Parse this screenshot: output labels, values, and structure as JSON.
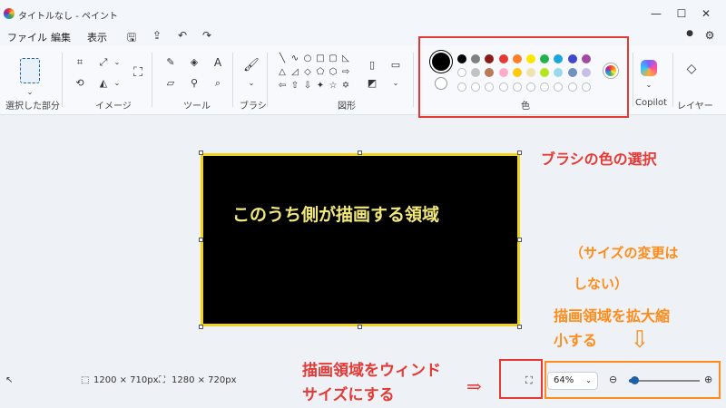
{
  "window": {
    "title": "タイトルなし - ペイント",
    "min_icon": "—",
    "max_icon": "☐",
    "close_icon": "✕"
  },
  "menu": {
    "file": "ファイル",
    "edit": "編集",
    "view": "表示"
  },
  "ribbon": {
    "groups": {
      "selection": "選択した部分",
      "image": "イメージ",
      "tools": "ツール",
      "brushes": "ブラシ",
      "shapes": "図形",
      "colors": "色",
      "copilot": "Copilot",
      "layers": "レイヤー"
    },
    "colors": {
      "primary": "#000000",
      "secondary": "#ffffff",
      "row1": [
        "#000000",
        "#7f7f7f",
        "#8b1a1a",
        "#e53935",
        "#ff7f27",
        "#ffe600",
        "#22b14c",
        "#1aa6d9",
        "#3f48cc",
        "#a349a4"
      ],
      "row2": [
        "#ffffff",
        "#c3c3c3",
        "#b97a57",
        "#ffaec9",
        "#ffc90e",
        "#efe4b0",
        "#b5e61d",
        "#99d9ea",
        "#7092be",
        "#c8bfe7"
      ]
    }
  },
  "canvas": {
    "text": "このうち側が描画する領域",
    "border_color": "#f2d21b"
  },
  "status": {
    "image_size": "1200 × 710px",
    "canvas_size": "1280 × 720px",
    "zoom_value": "64%",
    "zoom_level_fraction": 0.04
  },
  "annotations": {
    "brush_color": "ブラシの色の選択",
    "size_note_line1": "（サイズの変更は",
    "size_note_line2": "しない）",
    "zoom_note_line1": "描画領域を拡大縮",
    "zoom_note_line2": "小する",
    "fit_note_line1": "描画領域をウィンド",
    "fit_note_line2": "サイズにする",
    "arrow_right": "⇒",
    "arrow_down": "⇩"
  }
}
